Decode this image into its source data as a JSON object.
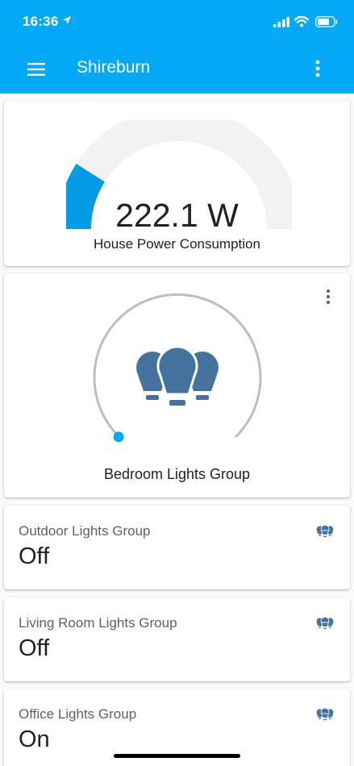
{
  "status_bar": {
    "time": "16:36"
  },
  "app_bar": {
    "title": "Shireburn",
    "menu_icon": "menu-icon",
    "more_icon": "more-vert-icon"
  },
  "colors": {
    "primary": "#03a9f4",
    "gauge_fill": "#039be5",
    "gauge_track": "#f2f2f2",
    "light_icon": "#44739e"
  },
  "power_card": {
    "value": "222.1 W",
    "name": "House Power Consumption",
    "gauge_level": 0.18
  },
  "light_card": {
    "name": "Bedroom Lights Group",
    "brightness_level": 0,
    "icon": "lightbulb-group-icon"
  },
  "entities": [
    {
      "name": "Outdoor Lights Group",
      "state": "Off",
      "icon": "lightbulb-group-icon"
    },
    {
      "name": "Living Room Lights Group",
      "state": "Off",
      "icon": "lightbulb-group-icon"
    },
    {
      "name": "Office Lights Group",
      "state": "On",
      "icon": "lightbulb-group-icon"
    }
  ]
}
